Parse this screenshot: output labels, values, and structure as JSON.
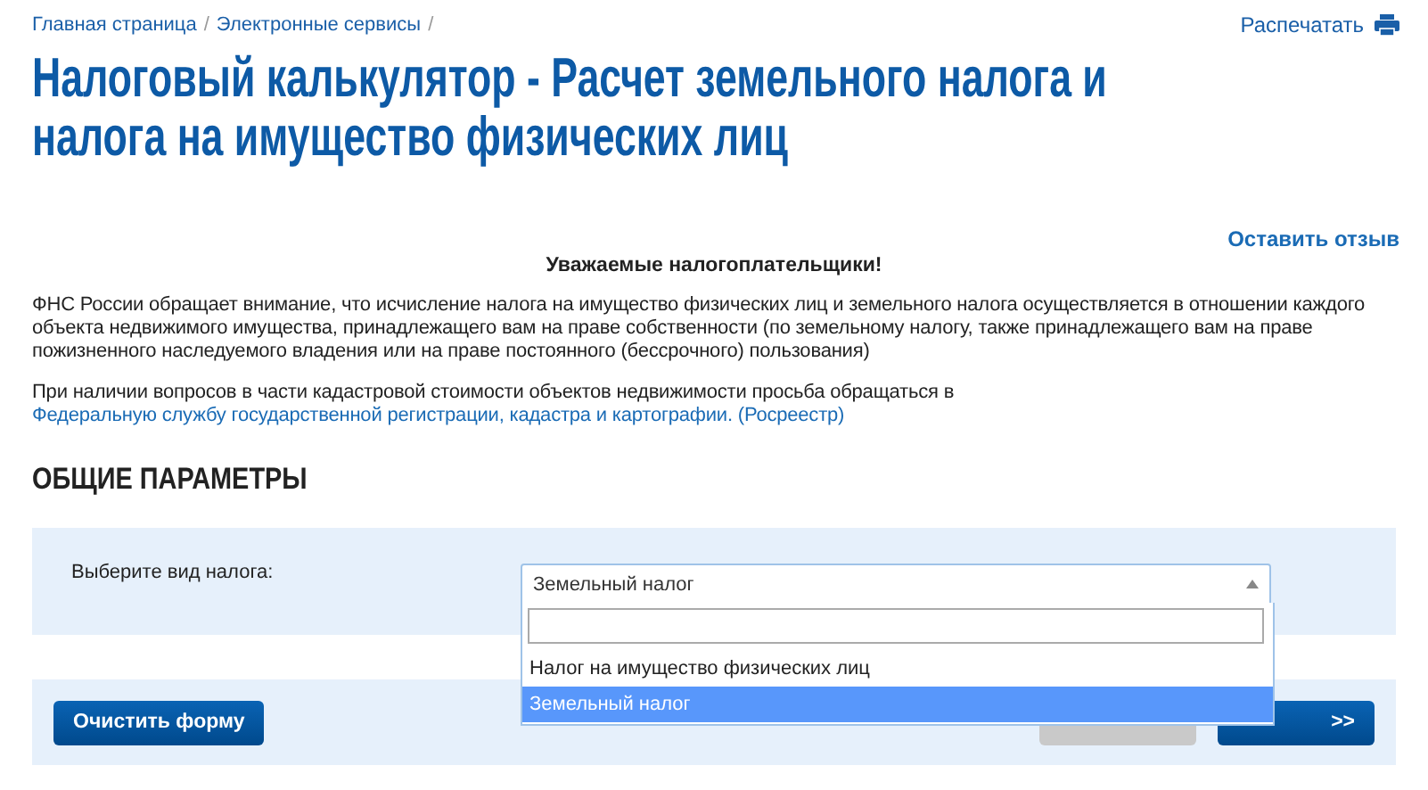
{
  "breadcrumbs": [
    {
      "label": "Главная страница",
      "separator": "/"
    },
    {
      "label": "Электронные сервисы",
      "separator": "/"
    }
  ],
  "print_link": {
    "label": "Распечатать"
  },
  "title_lines": [
    "Налоговый калькулятор - Расчет земельного налога и",
    "налога на имущество физических лиц"
  ],
  "feedback_link": {
    "label": "Оставить отзыв"
  },
  "notice": {
    "heading": "Уважаемые налогоплательщики!",
    "paragraph": "ФНС России обращает внимание, что исчисление налога на имущество физических лиц и земельного налога осуществляется в отношении каждого объекта недвижимого имущества, принадлежащего вам на праве собственности (по земельному налогу, также принадлежащего вам на праве пожизненного наследуемого владения или на праве постоянного (бессрочного) пользования)",
    "contact_text": "При наличии вопросов в части кадастровой стоимости объектов недвижимости просьба обращаться в",
    "contact_link": "Федеральную службу государственной регистрации, кадастра и картографии. (Росреестр)"
  },
  "section_title": "ОБЩИЕ ПАРАМЕТРЫ",
  "tax_select": {
    "label": "Выберите вид налога:",
    "value": "Земельный налог",
    "expanded": true,
    "options": [
      {
        "label": "Налог на имущество физических лиц",
        "selected": false
      },
      {
        "label": "Земельный налог",
        "selected": true
      }
    ]
  },
  "buttons": [
    {
      "label": "Очистить форму",
      "disabled": false
    },
    {
      "disabled": true
    },
    {
      "label": ">>",
      "disabled": false
    }
  ]
}
